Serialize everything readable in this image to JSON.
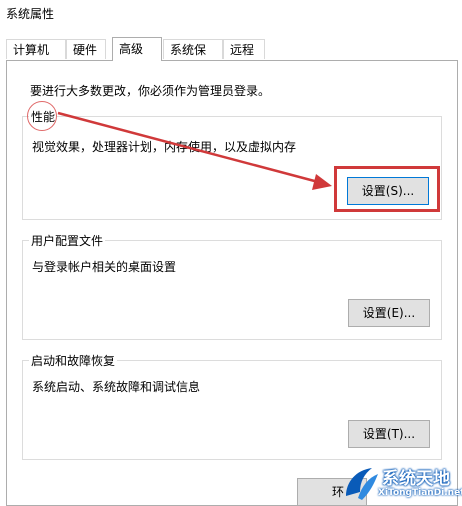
{
  "window": {
    "title": "系统属性"
  },
  "tabs": [
    {
      "label": "计算机名"
    },
    {
      "label": "硬件"
    },
    {
      "label": "高级",
      "active": true
    },
    {
      "label": "系统保护"
    },
    {
      "label": "远程"
    }
  ],
  "admin_note": "要进行大多数更改，你必须作为管理员登录。",
  "performance": {
    "title": "性能",
    "description": "视觉效果，处理器计划，内存使用，以及虚拟内存",
    "button": "设置(S)..."
  },
  "user_profiles": {
    "title": "用户配置文件",
    "description": "与登录帐户相关的桌面设置",
    "button": "设置(E)..."
  },
  "startup_recovery": {
    "title": "启动和故障恢复",
    "description": "系统启动、系统故障和调试信息",
    "button": "设置(T)..."
  },
  "bottom_button_partial": "环",
  "watermark": {
    "text": "系统天地",
    "url": "XiTongTianDi.net"
  },
  "colors": {
    "annotation_red": "#d0393a",
    "accent_blue": "#0078d7",
    "watermark_blue": "#0a5bb8"
  }
}
